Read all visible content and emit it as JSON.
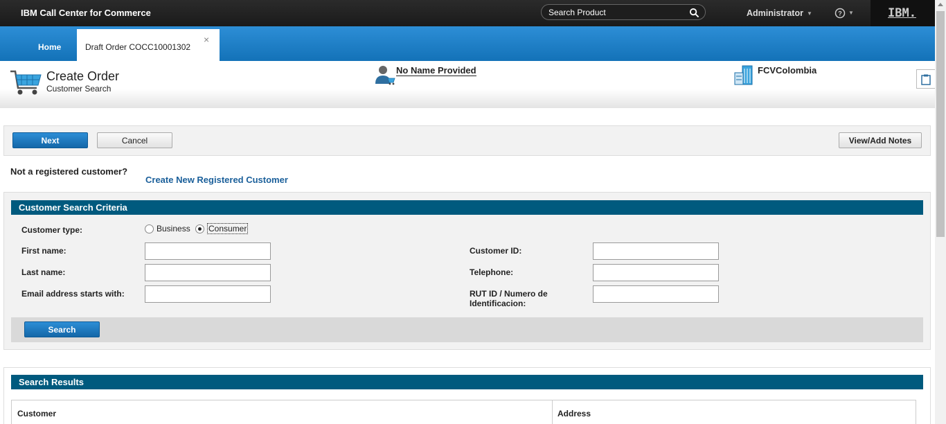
{
  "topbar": {
    "app_title": "IBM Call Center for Commerce",
    "search_placeholder": "Search Product",
    "user": "Administrator",
    "logo": "IBM."
  },
  "tabs": {
    "home": "Home",
    "active": "Draft Order COCC10001302",
    "close_glyph": "×"
  },
  "header": {
    "title": "Create Order",
    "subtitle": "Customer Search",
    "customer": "No Name Provided",
    "organization": "FCVColombia"
  },
  "actions": {
    "next": "Next",
    "cancel": "Cancel",
    "notes": "View/Add Notes"
  },
  "registration": {
    "prompt": "Not a registered customer?",
    "link": "Create New Registered Customer"
  },
  "criteria": {
    "title": "Customer Search Criteria",
    "customer_type_label": "Customer type:",
    "type_options": [
      "Business",
      "Consumer"
    ],
    "selected_type": "Consumer",
    "first_name_label": "First name:",
    "last_name_label": "Last name:",
    "email_label": "Email address starts with:",
    "customer_id_label": "Customer ID:",
    "telephone_label": "Telephone:",
    "rut_label": "RUT ID / Numero de Identificacion:",
    "search_button": "Search"
  },
  "results": {
    "title": "Search Results",
    "columns": [
      "Customer",
      "Address"
    ]
  },
  "colors": {
    "section_header": "#005a7e",
    "primary_button": "#1e7cc4",
    "link": "#1a5f9a",
    "tabbar": "#1f82c8"
  }
}
